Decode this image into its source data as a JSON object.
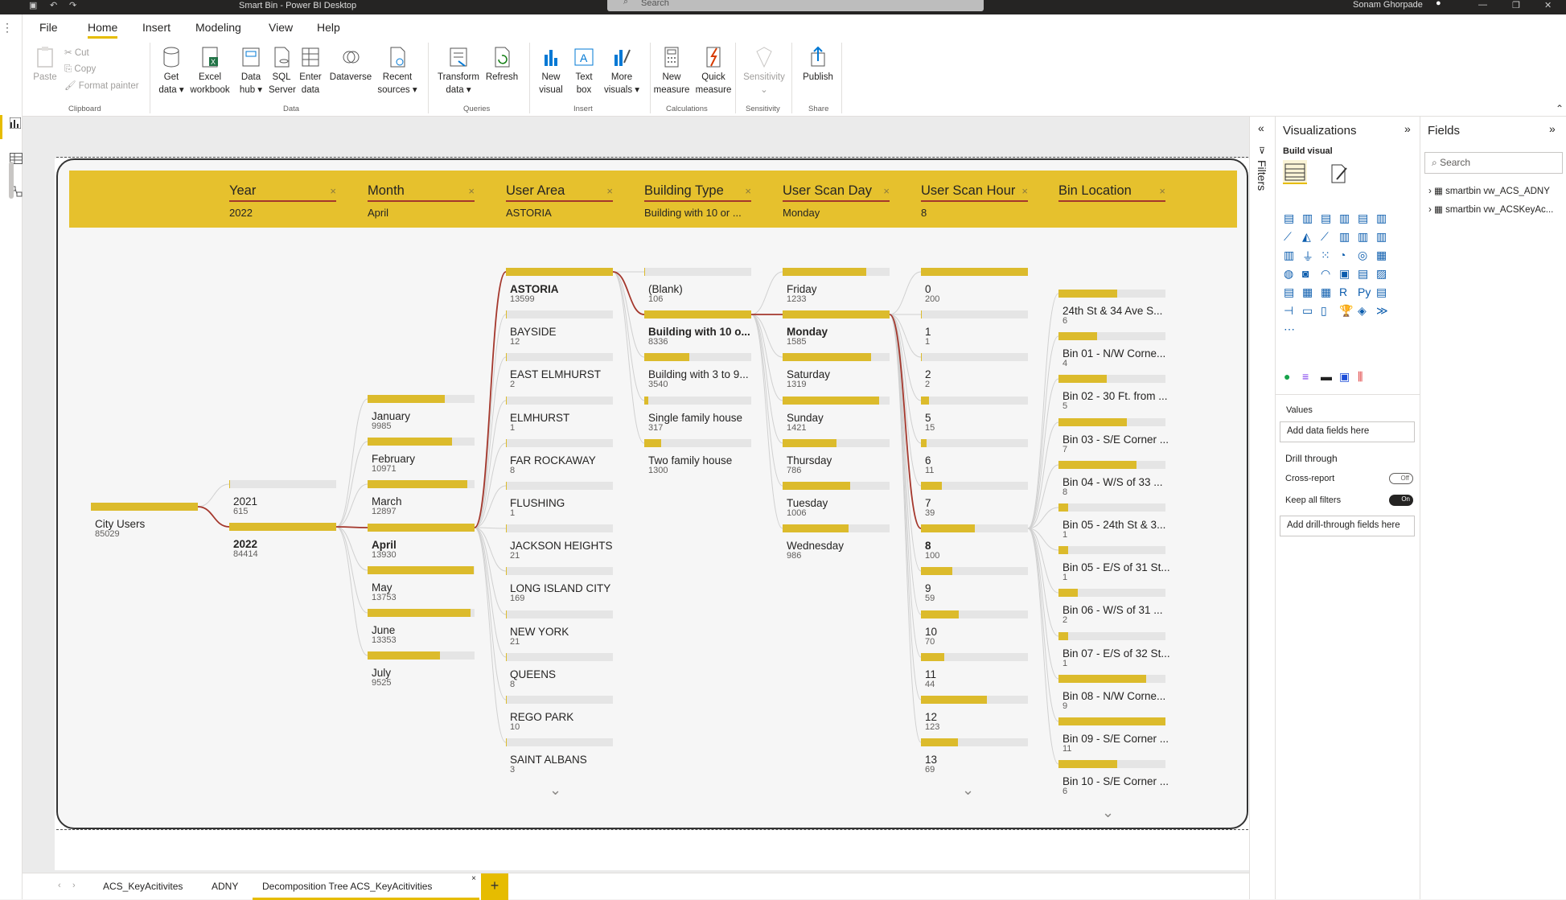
{
  "window": {
    "title": "Smart Bin - Power BI Desktop",
    "search_placeholder": "Search",
    "user": "Sonam Ghorpade"
  },
  "ribbon_tabs": [
    "File",
    "Home",
    "Insert",
    "Modeling",
    "View",
    "Help"
  ],
  "ribbon": {
    "clipboard": {
      "paste": "Paste",
      "cut": "Cut",
      "copy": "Copy",
      "format_painter": "Format painter",
      "group": "Clipboard"
    },
    "data": {
      "get_data": "Get data",
      "excel": "Excel workbook",
      "data_hub": "Data hub",
      "sql": "SQL Server",
      "enter": "Enter data",
      "dataverse": "Dataverse",
      "recent": "Recent sources",
      "group": "Data"
    },
    "queries": {
      "transform": "Transform data",
      "refresh": "Refresh",
      "group": "Queries"
    },
    "insert": {
      "new_visual": "New visual",
      "text_box": "Text box",
      "more_visuals": "More visuals",
      "group": "Insert"
    },
    "calculations": {
      "new_measure": "New measure",
      "quick_measure": "Quick measure",
      "group": "Calculations"
    },
    "sensitivity": {
      "label": "Sensitivity",
      "group": "Sensitivity"
    },
    "share": {
      "publish": "Publish",
      "group": "Share"
    }
  },
  "tree": {
    "headers": [
      {
        "label": "Year",
        "value": "2022"
      },
      {
        "label": "Month",
        "value": "April"
      },
      {
        "label": "User Area",
        "value": "ASTORIA"
      },
      {
        "label": "Building Type",
        "value": "Building with 10 or ..."
      },
      {
        "label": "User Scan Day",
        "value": "Monday"
      },
      {
        "label": "User Scan Hour",
        "value": "8"
      },
      {
        "label": "Bin Location",
        "value": ""
      }
    ],
    "root": {
      "label": "City Users",
      "value": "85029",
      "fill": 1.0
    },
    "levels": [
      [
        {
          "label": "2021",
          "value": "615",
          "fill": 0.01
        },
        {
          "label": "2022",
          "value": "84414",
          "fill": 1.0,
          "selected": true
        }
      ],
      [
        {
          "label": "January",
          "value": "9985",
          "fill": 0.72
        },
        {
          "label": "February",
          "value": "10971",
          "fill": 0.79
        },
        {
          "label": "March",
          "value": "12897",
          "fill": 0.93
        },
        {
          "label": "April",
          "value": "13930",
          "fill": 1.0,
          "selected": true
        },
        {
          "label": "May",
          "value": "13753",
          "fill": 0.99
        },
        {
          "label": "June",
          "value": "13353",
          "fill": 0.96
        },
        {
          "label": "July",
          "value": "9525",
          "fill": 0.68
        }
      ],
      [
        {
          "label": "ASTORIA",
          "value": "13599",
          "fill": 1.0,
          "selected": true
        },
        {
          "label": "BAYSIDE",
          "value": "12",
          "fill": 0.0
        },
        {
          "label": "EAST ELMHURST",
          "value": "2",
          "fill": 0.0
        },
        {
          "label": "ELMHURST",
          "value": "1",
          "fill": 0.0
        },
        {
          "label": "FAR ROCKAWAY",
          "value": "8",
          "fill": 0.0
        },
        {
          "label": "FLUSHING",
          "value": "1",
          "fill": 0.0
        },
        {
          "label": "JACKSON HEIGHTS",
          "value": "21",
          "fill": 0.0
        },
        {
          "label": "LONG ISLAND CITY",
          "value": "169",
          "fill": 0.01
        },
        {
          "label": "NEW YORK",
          "value": "21",
          "fill": 0.0
        },
        {
          "label": "QUEENS",
          "value": "8",
          "fill": 0.0
        },
        {
          "label": "REGO PARK",
          "value": "10",
          "fill": 0.0
        },
        {
          "label": "SAINT ALBANS",
          "value": "3",
          "fill": 0.0
        }
      ],
      [
        {
          "label": "(Blank)",
          "value": "106",
          "fill": 0.01
        },
        {
          "label": "Building with 10 o...",
          "value": "8336",
          "fill": 1.0,
          "selected": true
        },
        {
          "label": "Building with 3 to 9...",
          "value": "3540",
          "fill": 0.42
        },
        {
          "label": "Single family house",
          "value": "317",
          "fill": 0.04
        },
        {
          "label": "Two family house",
          "value": "1300",
          "fill": 0.16
        }
      ],
      [
        {
          "label": "Friday",
          "value": "1233",
          "fill": 0.78
        },
        {
          "label": "Monday",
          "value": "1585",
          "fill": 1.0,
          "selected": true
        },
        {
          "label": "Saturday",
          "value": "1319",
          "fill": 0.83
        },
        {
          "label": "Sunday",
          "value": "1421",
          "fill": 0.9
        },
        {
          "label": "Thursday",
          "value": "786",
          "fill": 0.5
        },
        {
          "label": "Tuesday",
          "value": "1006",
          "fill": 0.63
        },
        {
          "label": "Wednesday",
          "value": "986",
          "fill": 0.62
        }
      ],
      [
        {
          "label": "0",
          "value": "200",
          "fill": 1.0
        },
        {
          "label": "1",
          "value": "1",
          "fill": 0.005
        },
        {
          "label": "2",
          "value": "2",
          "fill": 0.01
        },
        {
          "label": "5",
          "value": "15",
          "fill": 0.075
        },
        {
          "label": "6",
          "value": "11",
          "fill": 0.055
        },
        {
          "label": "7",
          "value": "39",
          "fill": 0.195
        },
        {
          "label": "8",
          "value": "100",
          "fill": 0.5,
          "selected": true
        },
        {
          "label": "9",
          "value": "59",
          "fill": 0.295
        },
        {
          "label": "10",
          "value": "70",
          "fill": 0.35
        },
        {
          "label": "11",
          "value": "44",
          "fill": 0.22
        },
        {
          "label": "12",
          "value": "123",
          "fill": 0.615
        },
        {
          "label": "13",
          "value": "69",
          "fill": 0.345
        }
      ],
      [
        {
          "label": "24th St & 34 Ave S...",
          "value": "6",
          "fill": 0.55
        },
        {
          "label": "Bin 01 - N/W Corne...",
          "value": "4",
          "fill": 0.36
        },
        {
          "label": "Bin 02 - 30 Ft. from ...",
          "value": "5",
          "fill": 0.45
        },
        {
          "label": "Bin 03 - S/E Corner ...",
          "value": "7",
          "fill": 0.64
        },
        {
          "label": "Bin 04 - W/S of 33 ...",
          "value": "8",
          "fill": 0.73
        },
        {
          "label": "Bin 05 - 24th St & 3...",
          "value": "1",
          "fill": 0.09
        },
        {
          "label": "Bin 05 - E/S of 31 St...",
          "value": "1",
          "fill": 0.09
        },
        {
          "label": "Bin 06 - W/S of 31 ...",
          "value": "2",
          "fill": 0.18
        },
        {
          "label": "Bin 07 - E/S of 32 St...",
          "value": "1",
          "fill": 0.09
        },
        {
          "label": "Bin 08 - N/W Corne...",
          "value": "9",
          "fill": 0.82
        },
        {
          "label": "Bin 09 - S/E Corner ...",
          "value": "11",
          "fill": 1.0
        },
        {
          "label": "Bin 10 - S/E Corner ...",
          "value": "6",
          "fill": 0.55
        }
      ]
    ]
  },
  "page_tabs": [
    "ACS_KeyAcitivites",
    "ADNY",
    "Decomposition Tree ACS_KeyAcitivities"
  ],
  "filters": {
    "label": "Filters"
  },
  "visualizations": {
    "title": "Visualizations",
    "build_visual": "Build visual",
    "values": "Values",
    "add_data_fields": "Add data fields here",
    "drill_through": "Drill through",
    "cross_report": "Cross-report",
    "cross_report_state": "Off",
    "keep_all_filters": "Keep all filters",
    "keep_all_filters_state": "On",
    "add_drill_fields": "Add drill-through fields here"
  },
  "fields": {
    "title": "Fields",
    "search_placeholder": "Search",
    "tables": [
      "smartbin vw_ACS_ADNY",
      "smartbin vw_ACSKeyAc..."
    ]
  },
  "colors": {
    "accent": "#e6c12d",
    "bar": "#dcbb2c",
    "link_selected": "#a4372c"
  }
}
